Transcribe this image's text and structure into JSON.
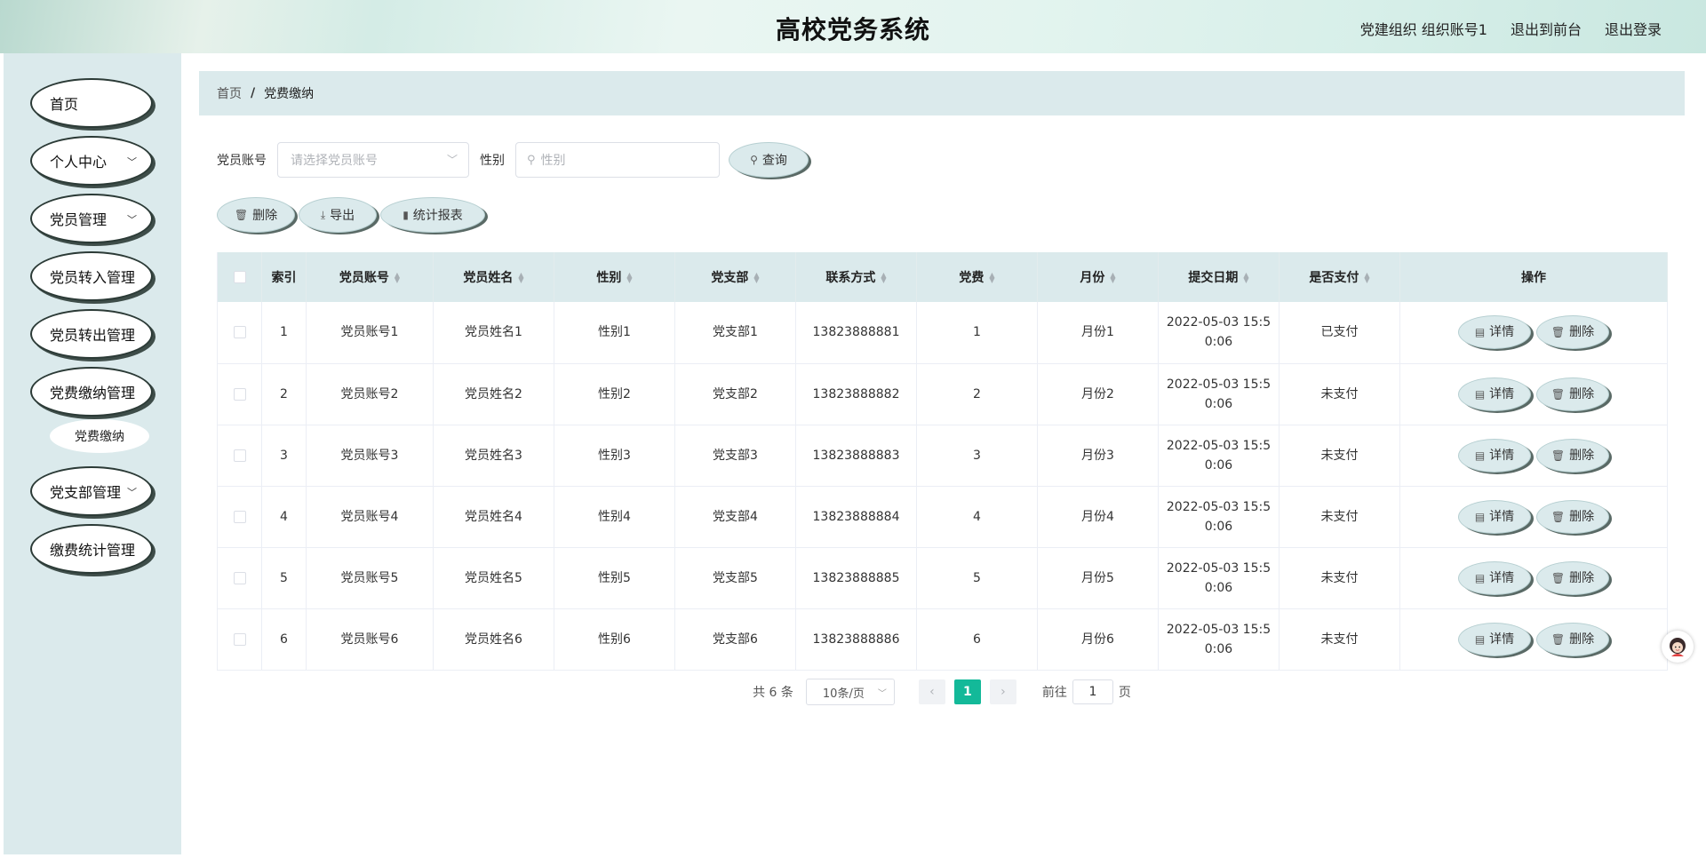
{
  "header": {
    "title": "高校党务系统",
    "user": "党建组织 组织账号1",
    "to_front": "退出到前台",
    "logout": "退出登录"
  },
  "sidebar": {
    "items": [
      {
        "label": "首页",
        "has_arrow": false
      },
      {
        "label": "个人中心",
        "has_arrow": true
      },
      {
        "label": "党员管理",
        "has_arrow": true
      },
      {
        "label": "党员转入管理",
        "has_arrow": false
      },
      {
        "label": "党员转出管理",
        "has_arrow": false
      },
      {
        "label": "党费缴纳管理",
        "has_arrow": false
      },
      {
        "label": "党支部管理",
        "has_arrow": true
      },
      {
        "label": "缴费统计管理",
        "has_arrow": false
      }
    ],
    "sub_item": "党费缴纳"
  },
  "breadcrumb": {
    "home": "首页",
    "sep": "/",
    "current": "党费缴纳"
  },
  "search": {
    "account_label": "党员账号",
    "account_placeholder": "请选择党员账号",
    "gender_label": "性别",
    "gender_placeholder": "性别",
    "query_button": "查询"
  },
  "actions": {
    "delete": "删除",
    "export": "导出",
    "report": "统计报表"
  },
  "table": {
    "columns": [
      "索引",
      "党员账号",
      "党员姓名",
      "性别",
      "党支部",
      "联系方式",
      "党费",
      "月份",
      "提交日期",
      "是否支付",
      "操作"
    ],
    "rows": [
      {
        "index": "1",
        "account": "党员账号1",
        "name": "党员姓名1",
        "gender": "性别1",
        "branch": "党支部1",
        "phone": "13823888881",
        "fee": "1",
        "month": "月份1",
        "date": "2022-05-03 15:50:06",
        "paid": "已支付"
      },
      {
        "index": "2",
        "account": "党员账号2",
        "name": "党员姓名2",
        "gender": "性别2",
        "branch": "党支部2",
        "phone": "13823888882",
        "fee": "2",
        "month": "月份2",
        "date": "2022-05-03 15:50:06",
        "paid": "未支付"
      },
      {
        "index": "3",
        "account": "党员账号3",
        "name": "党员姓名3",
        "gender": "性别3",
        "branch": "党支部3",
        "phone": "13823888883",
        "fee": "3",
        "month": "月份3",
        "date": "2022-05-03 15:50:06",
        "paid": "未支付"
      },
      {
        "index": "4",
        "account": "党员账号4",
        "name": "党员姓名4",
        "gender": "性别4",
        "branch": "党支部4",
        "phone": "13823888884",
        "fee": "4",
        "month": "月份4",
        "date": "2022-05-03 15:50:06",
        "paid": "未支付"
      },
      {
        "index": "5",
        "account": "党员账号5",
        "name": "党员姓名5",
        "gender": "性别5",
        "branch": "党支部5",
        "phone": "13823888885",
        "fee": "5",
        "month": "月份5",
        "date": "2022-05-03 15:50:06",
        "paid": "未支付"
      },
      {
        "index": "6",
        "account": "党员账号6",
        "name": "党员姓名6",
        "gender": "性别6",
        "branch": "党支部6",
        "phone": "13823888886",
        "fee": "6",
        "month": "月份6",
        "date": "2022-05-03 15:50:06",
        "paid": "未支付"
      }
    ],
    "detail_button": "详情",
    "delete_button": "删除"
  },
  "pagination": {
    "total": "共 6 条",
    "page_size": "10条/页",
    "current_page": "1",
    "goto_label": "前往",
    "goto_value": "1",
    "page_suffix": "页"
  },
  "colors": {
    "accent": "#13b999",
    "panel": "#dbeaec",
    "header_bg": "#e3f4ef"
  }
}
